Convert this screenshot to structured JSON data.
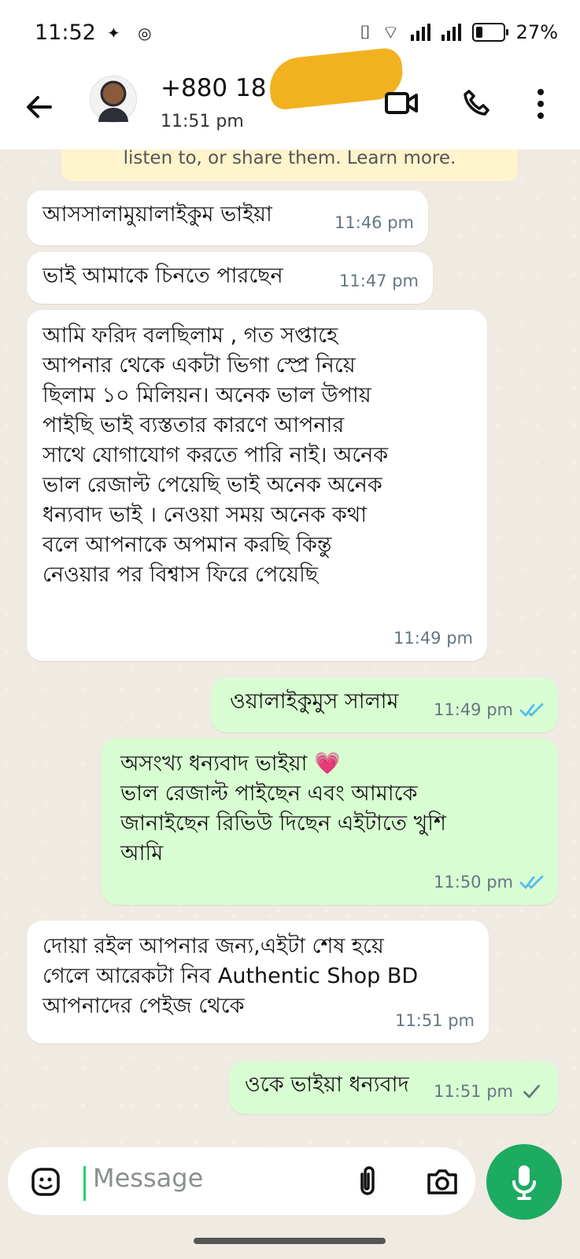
{
  "status": {
    "time": "11:52",
    "battery": "27%"
  },
  "header": {
    "contact": "+880 18",
    "last_seen": "11:51 pm"
  },
  "notice": {
    "text": "listen to, or share them. Learn more."
  },
  "messages": [
    {
      "direction": "in",
      "text": "আসসালামুয়ালাইকুম ভাইয়া",
      "time": "11:46 pm"
    },
    {
      "direction": "in",
      "text": "ভাই আমাকে চিনতে পারছেন",
      "time": "11:47 pm"
    },
    {
      "direction": "in",
      "text": "আমি ফরিদ বলছিলাম , গত সপ্তাহে\nআপনার থেকে একটা ভিগা স্প্রে নিয়ে\nছিলাম ১০ মিলিয়ন। অনেক ভাল উপায়\nপাইছি ভাই ব্যস্ততার কারণে আপনার\nসাথে যোগাযোগ করতে পারি নাই। অনেক\nভাল রেজাল্ট পেয়েছি ভাই অনেক অনেক\nধন্যবাদ ভাই । নেওয়া সময় অনেক কথা\nবলে আপনাকে অপমান করছি কিন্তু\nনেওয়ার পর বিশ্বাস ফিরে পেয়েছি",
      "time": "11:49 pm"
    },
    {
      "direction": "out",
      "text": "ওয়ালাইকুমুস সালাম",
      "time": "11:49 pm",
      "status": "read"
    },
    {
      "direction": "out",
      "text": "অসংখ্য ধন্যবাদ ভাইয়া 💗\nভাল রেজাল্ট পাইছেন এবং আমাকে\nজানাইছেন রিভিউ দিছেন এইটাতে খুশি\nআমি",
      "time": "11:50 pm",
      "status": "read"
    },
    {
      "direction": "in",
      "text": "দোয়া রইল আপনার জন্য,এইটা শেষ হয়ে\nগেলে আরেকটা নিব Authentic Shop BD\nআপনাদের পেইজ থেকে",
      "time": "11:51 pm"
    },
    {
      "direction": "out",
      "text": "ওকে ভাইয়া ধন্যবাদ",
      "time": "11:51 pm",
      "status": "sent"
    }
  ],
  "composer": {
    "placeholder": "Message"
  },
  "icons": {
    "back": "back-arrow-icon",
    "video": "video-call-icon",
    "phone": "voice-call-icon",
    "menu": "more-options-icon",
    "emoji": "sticker-icon",
    "attach": "attachment-icon",
    "camera": "camera-icon",
    "mic": "microphone-icon"
  },
  "colors": {
    "incoming": "#ffffff",
    "outgoing": "#d9fdd3",
    "accent": "#1daa61",
    "read_tick": "#53bdeb"
  }
}
